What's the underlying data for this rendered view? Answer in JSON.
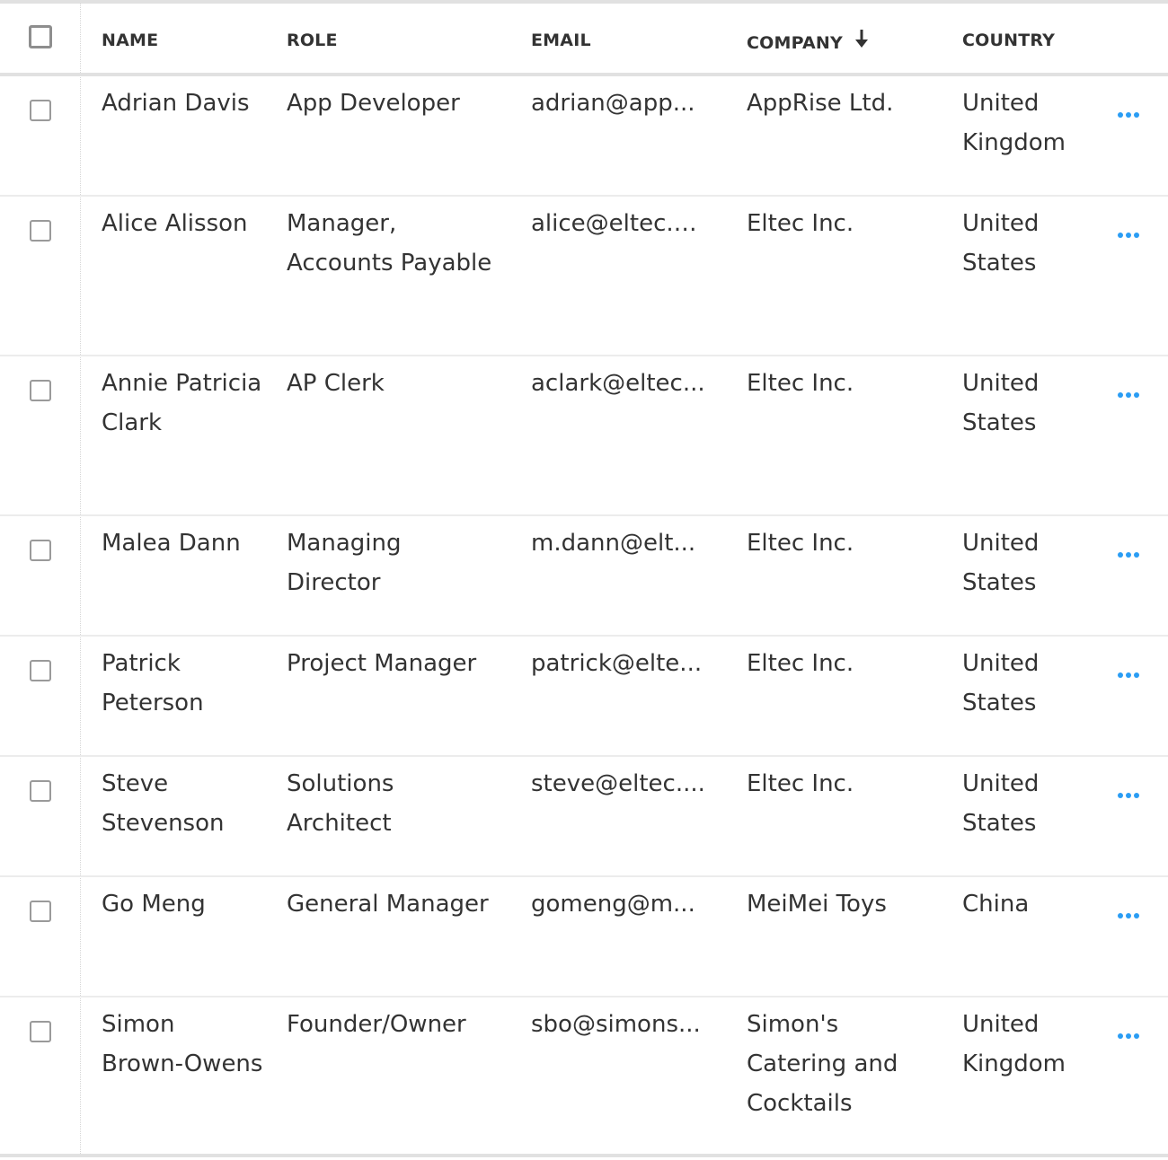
{
  "header": {
    "select_all_checked": false,
    "columns": {
      "name": "NAME",
      "role": "ROLE",
      "email": "EMAIL",
      "company": "COMPANY",
      "country": "COUNTRY"
    },
    "sorted_column": "company",
    "sort_direction": "descending",
    "sort_icon": "arrow-down-icon"
  },
  "colors": {
    "accent": "#2a9df4",
    "text": "#333333",
    "border": "#e1e1e1"
  },
  "rows": [
    {
      "name": "Adrian Davis",
      "role": "App Developer",
      "email": "adrian@app...",
      "company": "AppRise Ltd.",
      "country": "United Kingdom",
      "checked": false,
      "row_lines": 2
    },
    {
      "name": "Alice Alisson",
      "role": "Manager, Accounts Payable",
      "email": "alice@eltec.c...",
      "company": "Eltec Inc.",
      "country": "United States",
      "checked": false,
      "row_lines": 3
    },
    {
      "name": "Annie Patricia Clark",
      "role": "AP Clerk",
      "email": "aclark@eltec...",
      "company": "Eltec Inc.",
      "country": "United States",
      "checked": false,
      "row_lines": 3
    },
    {
      "name": "Malea Dann",
      "role": "Managing Director",
      "email": "m.dann@elt...",
      "company": "Eltec Inc.",
      "country": "United States",
      "checked": false,
      "row_lines": 2
    },
    {
      "name": "Patrick Peterson",
      "role": "Project Manager",
      "email": "patrick@elte...",
      "company": "Eltec Inc.",
      "country": "United States",
      "checked": false,
      "row_lines": 2
    },
    {
      "name": "Steve Stevenson",
      "role": "Solutions Architect",
      "email": "steve@eltec....",
      "company": "Eltec Inc.",
      "country": "United States",
      "checked": false,
      "row_lines": 2
    },
    {
      "name": "Go Meng",
      "role": "General Manager",
      "email": "gomeng@m...",
      "company": "MeiMei Toys",
      "country": "China",
      "checked": false,
      "row_lines": 2
    },
    {
      "name": "Simon Brown-Owens",
      "role": "Founder/Owner",
      "email": "sbo@simons...",
      "company": "Simon's Catering and Cocktails",
      "country": "United Kingdom",
      "checked": false,
      "row_lines": 3
    }
  ],
  "row_action_icon": "more-horizontal-icon"
}
